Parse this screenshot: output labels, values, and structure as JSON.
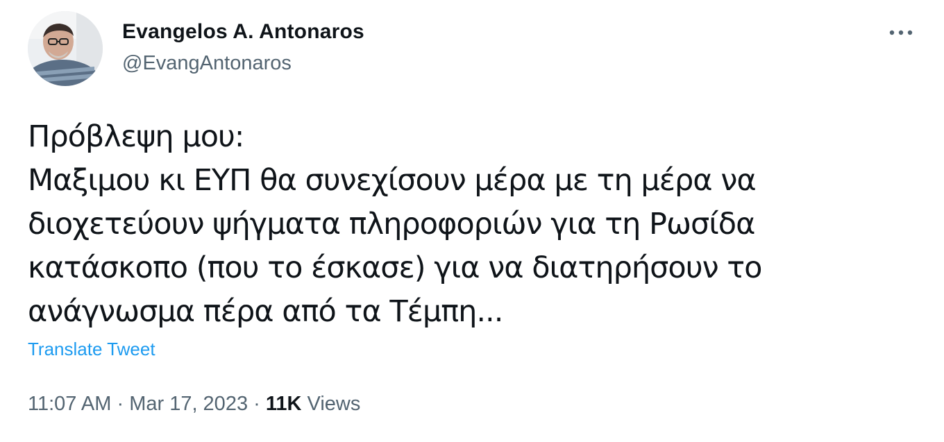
{
  "author": {
    "display_name": "Evangelos A. Antonaros",
    "handle": "@EvangAntonaros"
  },
  "tweet": {
    "lines": [
      "Πρόβλεψη μου:",
      "Μαξιμου κι ΕΥΠ θα συνεχίσουν μέρα με τη μέρα να",
      "διοχετεύουν ψήγματα πληροφοριών για τη Ρωσίδα",
      "κατάσκοπο (που το έσκασε) για να διατηρήσουν το",
      "ανάγνωσμα πέρα από τα Τέμπη..."
    ],
    "translate_label": "Translate Tweet"
  },
  "meta": {
    "time": "11:07 AM",
    "separator": "·",
    "date": "Mar 17, 2023",
    "views_count": "11K",
    "views_label": "Views"
  },
  "icons": {
    "more": "more-horizontal-icon"
  },
  "colors": {
    "text_primary": "#0f1419",
    "text_secondary": "#536471",
    "link": "#1d9bf0",
    "background": "#ffffff"
  }
}
